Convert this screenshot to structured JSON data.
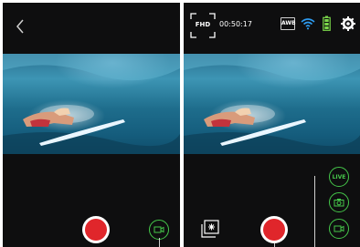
{
  "left_screen": {
    "back_icon": "chevron-left-icon",
    "record_icon": "record-icon",
    "video_mode_icon": "video-camera-icon"
  },
  "right_screen": {
    "resolution": "FHD",
    "timer": "00:50:17",
    "awb": "AWB",
    "wifi_icon": "wifi-icon",
    "battery_icon": "battery-icon",
    "settings_icon": "gear-icon",
    "live_label": "LIVE",
    "photo_mode_icon": "camera-icon",
    "video_mode_icon": "video-camera-icon",
    "gallery_icon": "gallery-icon",
    "record_icon": "record-icon"
  },
  "colors": {
    "accent_green": "#45c74a",
    "record_red": "#e0262b",
    "battery_green": "#7bd64a",
    "wifi_blue": "#2d9bf0"
  }
}
